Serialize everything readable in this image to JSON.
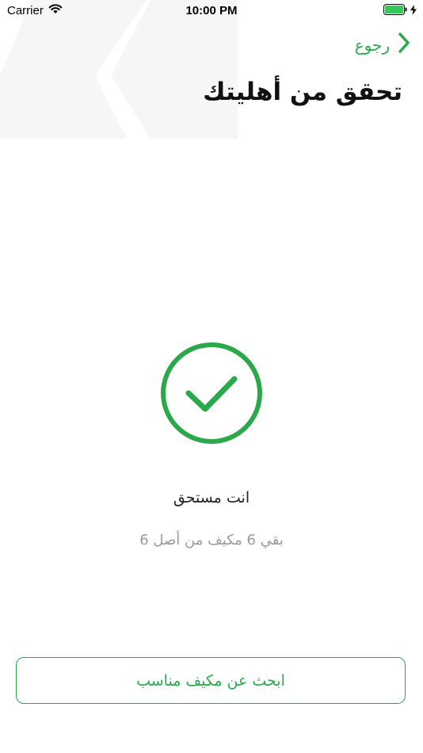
{
  "status_bar": {
    "carrier": "Carrier",
    "time": "10:00 PM"
  },
  "nav": {
    "back_label": "رجوع"
  },
  "page": {
    "title": "تحقق من أهليتك"
  },
  "result": {
    "status": "انت مستحق",
    "remaining": "بقي 6 مكيف من أصل 6"
  },
  "actions": {
    "search_label": "ابحث عن مكيف مناسب"
  },
  "colors": {
    "accent": "#2aa84a",
    "muted_text": "#9a9a9a"
  },
  "icons": {
    "back": "chevron-right-icon",
    "success": "checkmark-circle-icon",
    "wifi": "wifi-icon",
    "battery": "battery-icon",
    "charging": "charging-bolt-icon"
  }
}
